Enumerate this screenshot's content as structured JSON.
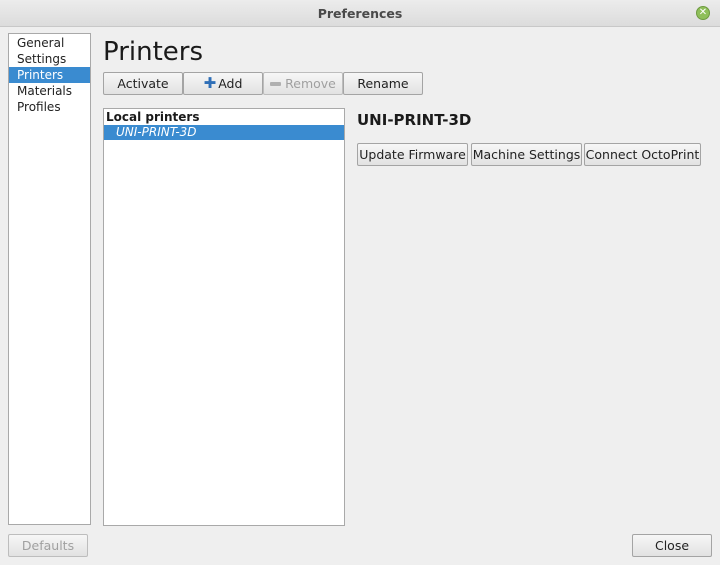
{
  "window": {
    "title": "Preferences"
  },
  "sidebar": {
    "items": [
      {
        "label": "General"
      },
      {
        "label": "Settings"
      },
      {
        "label": "Printers",
        "selected": true
      },
      {
        "label": "Materials"
      },
      {
        "label": "Profiles"
      }
    ]
  },
  "page": {
    "title": "Printers"
  },
  "toolbar": {
    "activate": "Activate",
    "add": "Add",
    "remove": "Remove",
    "rename": "Rename"
  },
  "printer_list": {
    "header": "Local printers",
    "items": [
      {
        "label": "UNI-PRINT-3D",
        "selected": true
      }
    ]
  },
  "printer_detail": {
    "name": "UNI-PRINT-3D",
    "actions": {
      "update_firmware": "Update Firmware",
      "machine_settings": "Machine Settings",
      "connect_octoprint": "Connect OctoPrint"
    }
  },
  "footer": {
    "defaults": "Defaults",
    "close": "Close"
  },
  "colors": {
    "selection": "#3a8bd0",
    "close_indicator": "#8fbf5a"
  }
}
